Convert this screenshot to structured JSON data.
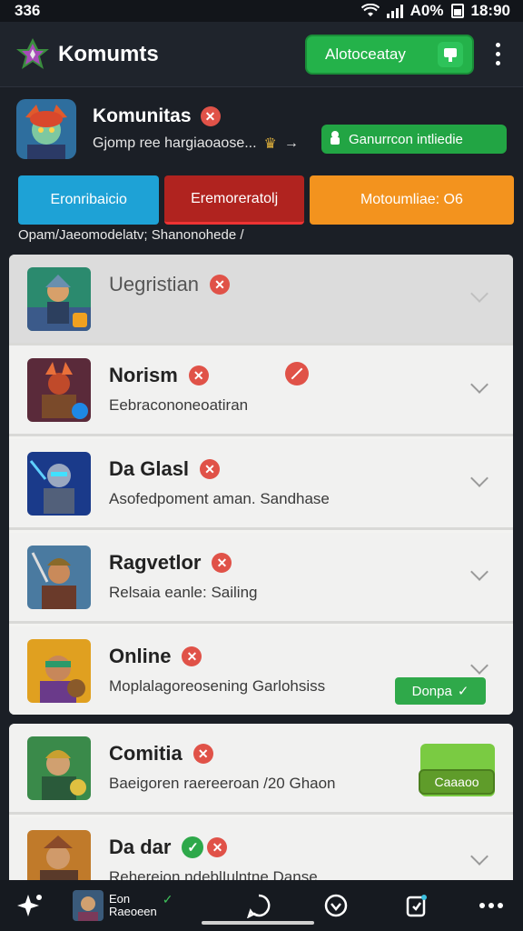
{
  "status_bar": {
    "time_left": "336",
    "battery_pct": "A0%",
    "clock": "18:90"
  },
  "app_bar": {
    "title": "Komumts",
    "cta_label": "Alotoceatay"
  },
  "community": {
    "name": "Komunitas",
    "description": "Gjomp ree hargiaoaose...",
    "arrow": "→",
    "action_label": "Ganurrcon intliedie"
  },
  "tabs": [
    "Eronribaicio",
    "Eremoreratolj",
    "Motoumliae: O6"
  ],
  "breadcrumb": "Opam/Jaeomodelatv; Shanonohede /",
  "list_items": [
    {
      "title": "Uegristian",
      "subtitle": "",
      "icon": "hero-knight-icon"
    },
    {
      "title": "Norism",
      "subtitle": "Eebracononeoatiran",
      "icon": "hero-dragon-icon"
    },
    {
      "title": "Da Glasl",
      "subtitle": "Asofedpoment aman. Sandhase",
      "icon": "hero-robot-icon"
    },
    {
      "title": "Ragvetlor",
      "subtitle": "Relsaia eanle: Sailing",
      "icon": "hero-warrior-icon"
    },
    {
      "title": "Online",
      "subtitle": "Moplalagoreosening Garlohsiss",
      "icon": "hero-archer-icon",
      "button": "Donpa"
    }
  ],
  "list_items_2": [
    {
      "title": "Comitia",
      "subtitle": "Baeigoren raereeroan /20 Ghaon",
      "icon": "hero-elf-icon",
      "button": "Caaaoo"
    },
    {
      "title": "Da dar",
      "subtitle": "Rehereion ndeblIulntne Danse",
      "icon": "hero-fighter-icon"
    }
  ],
  "bottom_nav": {
    "profile_line1": "Eon",
    "profile_line2": "Raeoeen"
  },
  "colors": {
    "accent_green": "#24b24a",
    "tab_blue": "#1ea2d6",
    "tab_red": "#b0231f",
    "tab_orange": "#f3931e",
    "badge_red": "#e05248"
  }
}
